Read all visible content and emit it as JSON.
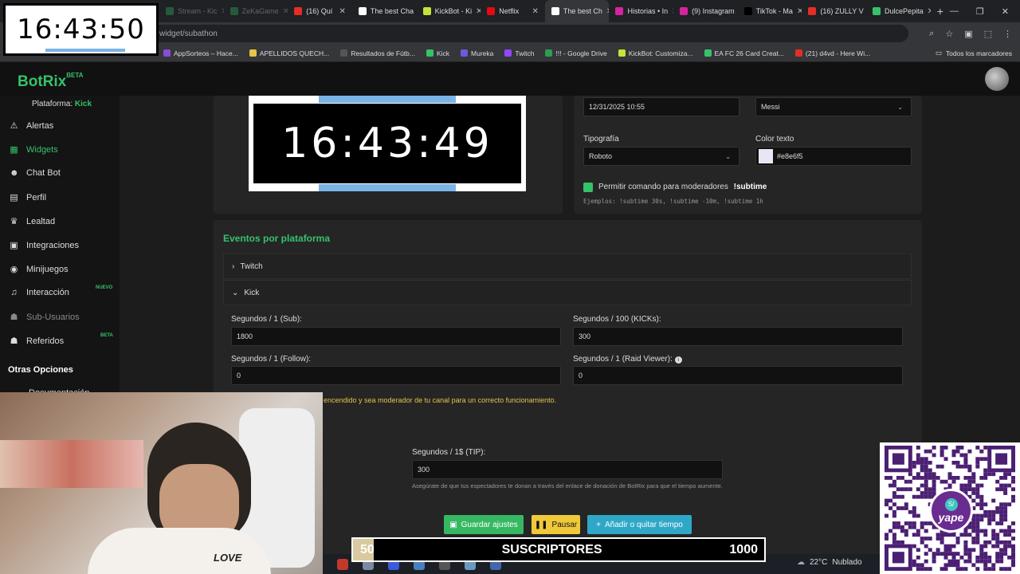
{
  "browser": {
    "tabs": [
      {
        "label": "Stream - Kic",
        "color": "#36c26a"
      },
      {
        "label": "ZeKaGame",
        "color": "#36c26a"
      },
      {
        "label": "(16) Quí",
        "color": "#e52d27"
      },
      {
        "label": "The best Cha",
        "color": "#ffffff"
      },
      {
        "label": "KickBot - Ki",
        "color": "#c5e33a"
      },
      {
        "label": "Netflix",
        "color": "#e50914"
      },
      {
        "label": "The best Ch",
        "color": "#ffffff"
      },
      {
        "label": "Historias • In",
        "color": "#d6249f"
      },
      {
        "label": "(9) Instagram",
        "color": "#d6249f"
      },
      {
        "label": "TikTok - Ma",
        "color": "#000000"
      },
      {
        "label": "(16) ZULLY V",
        "color": "#e52d27"
      },
      {
        "label": "DulcePepita",
        "color": "#36c26a"
      }
    ],
    "url": "widget/subathon",
    "bookmarks": [
      {
        "label": "AppSorteos – Hace...",
        "color": "#8a4bd6"
      },
      {
        "label": "APELLIDOS QUECH...",
        "color": "#e6c34a"
      },
      {
        "label": "Resultados de Fútb...",
        "color": "#555555"
      },
      {
        "label": "Kick",
        "color": "#36c26a"
      },
      {
        "label": "Mureka",
        "color": "#6b5bd6"
      },
      {
        "label": "Twitch",
        "color": "#9146ff"
      },
      {
        "label": "!!! - Google Drive",
        "color": "#2d9d4e"
      },
      {
        "label": "KickBot: Customiza...",
        "color": "#c5e33a"
      },
      {
        "label": "EA FC 26 Card Creat...",
        "color": "#36c26a"
      },
      {
        "label": "(21) d4vd - Here Wi...",
        "color": "#e52d27"
      }
    ],
    "all_bookmarks": "Todos los marcadores"
  },
  "overlay_clock": "16:43:50",
  "app": {
    "logo": "BotRix",
    "logo_badge": "BETA",
    "platform_label": "Plataforma:",
    "platform_value": "Kick"
  },
  "sidebar": {
    "items": [
      {
        "label": "Alertas",
        "icon": "bell-icon",
        "glyph": "⚠"
      },
      {
        "label": "Widgets",
        "icon": "grid-icon",
        "glyph": "▦"
      },
      {
        "label": "Chat Bot",
        "icon": "robot-icon",
        "glyph": "☻"
      },
      {
        "label": "Perfil",
        "icon": "id-card-icon",
        "glyph": "▤"
      },
      {
        "label": "Lealtad",
        "icon": "trophy-icon",
        "glyph": "♛"
      },
      {
        "label": "Integraciones",
        "icon": "plug-icon",
        "glyph": "▣"
      },
      {
        "label": "Minijuegos",
        "icon": "gamepad-icon",
        "glyph": "◉"
      },
      {
        "label": "Interacción",
        "icon": "music-icon",
        "glyph": "♫"
      },
      {
        "label": "Sub-Usuarios",
        "icon": "users-icon",
        "glyph": "☗"
      },
      {
        "label": "Referidos",
        "icon": "users-icon",
        "glyph": "☗"
      }
    ],
    "badge_new": "NUEVO",
    "badge_beta": "BETA",
    "other_options": "Otras Opciones",
    "docs": "Documentación"
  },
  "settings": {
    "date_value": "12/31/2025 10:55",
    "voice_value": "Messi",
    "font_label": "Tipografía",
    "font_value": "Roboto",
    "color_label": "Color texto",
    "color_value": "#e8e6f5",
    "mod_cmd_label": "Permitir comando para moderadores",
    "mod_cmd_value": "!subtime",
    "examples": "Ejemplos: !subtime 30s, !subtime -10m, !subtime 1h"
  },
  "preview": {
    "timer": "16:43:49"
  },
  "events": {
    "title": "Eventos por plataforma",
    "twitch": "Twitch",
    "kick": "Kick",
    "sub_label": "Segundos / 1 (Sub):",
    "sub_value": "1800",
    "kicks_label": "Segundos / 100 (KICKs):",
    "kicks_value": "300",
    "follow_label": "Segundos / 1 (Follow):",
    "follow_value": "0",
    "raid_label": "Segundos / 1 (Raid Viewer):",
    "raid_value": "0",
    "warning": "encendido y sea moderador de tu canal para un correcto funcionamiento.",
    "tip_label": "Segundos / 1$ (TIP):",
    "tip_value": "300",
    "tip_note": "Asegúrate de que tus espectadores te donan a través del enlace de donación de BotRix para que el tiempo aumente."
  },
  "buttons": {
    "save": "Guardar ajustes",
    "pause": "Pausar",
    "add": "Añadir o quitar tiempo"
  },
  "subgoal": {
    "current": "50",
    "label": "SUSCRIPTORES",
    "target": "1000",
    "progress": 0.05
  },
  "webcam": {
    "shirt_text": "LOVE"
  },
  "qr": {
    "brand": "yape",
    "badge": "S/"
  },
  "weather": {
    "temp": "22°C",
    "condition": "Nublado"
  }
}
